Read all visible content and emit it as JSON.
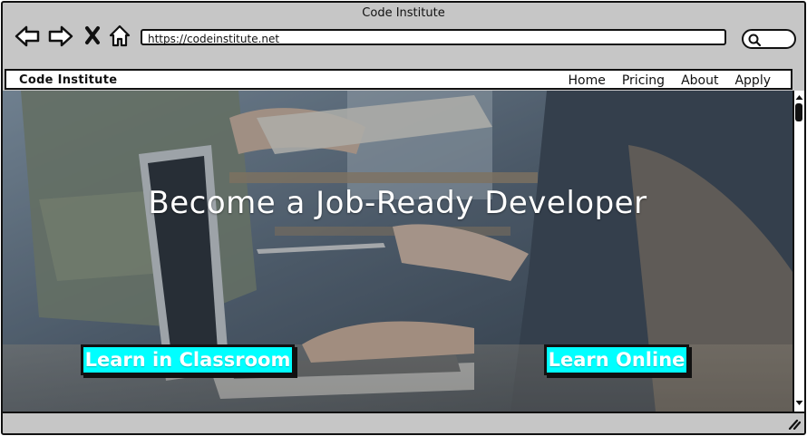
{
  "window": {
    "title": "Code Institute",
    "url": "https://codeinstitute.net"
  },
  "toolbar": {
    "icons": [
      "back-arrow-icon",
      "forward-arrow-icon",
      "close-icon",
      "home-icon",
      "search-icon"
    ]
  },
  "navbar": {
    "brand": "Code Institute",
    "links": [
      "Home",
      "Pricing",
      "About",
      "Apply"
    ]
  },
  "hero": {
    "headline": "Become a Job-Ready Developer",
    "cta_classroom": "Learn in Classroom",
    "cta_online": "Learn Online",
    "cta_color": "#00ffff",
    "background_image": "photo of people working at a laptop"
  }
}
